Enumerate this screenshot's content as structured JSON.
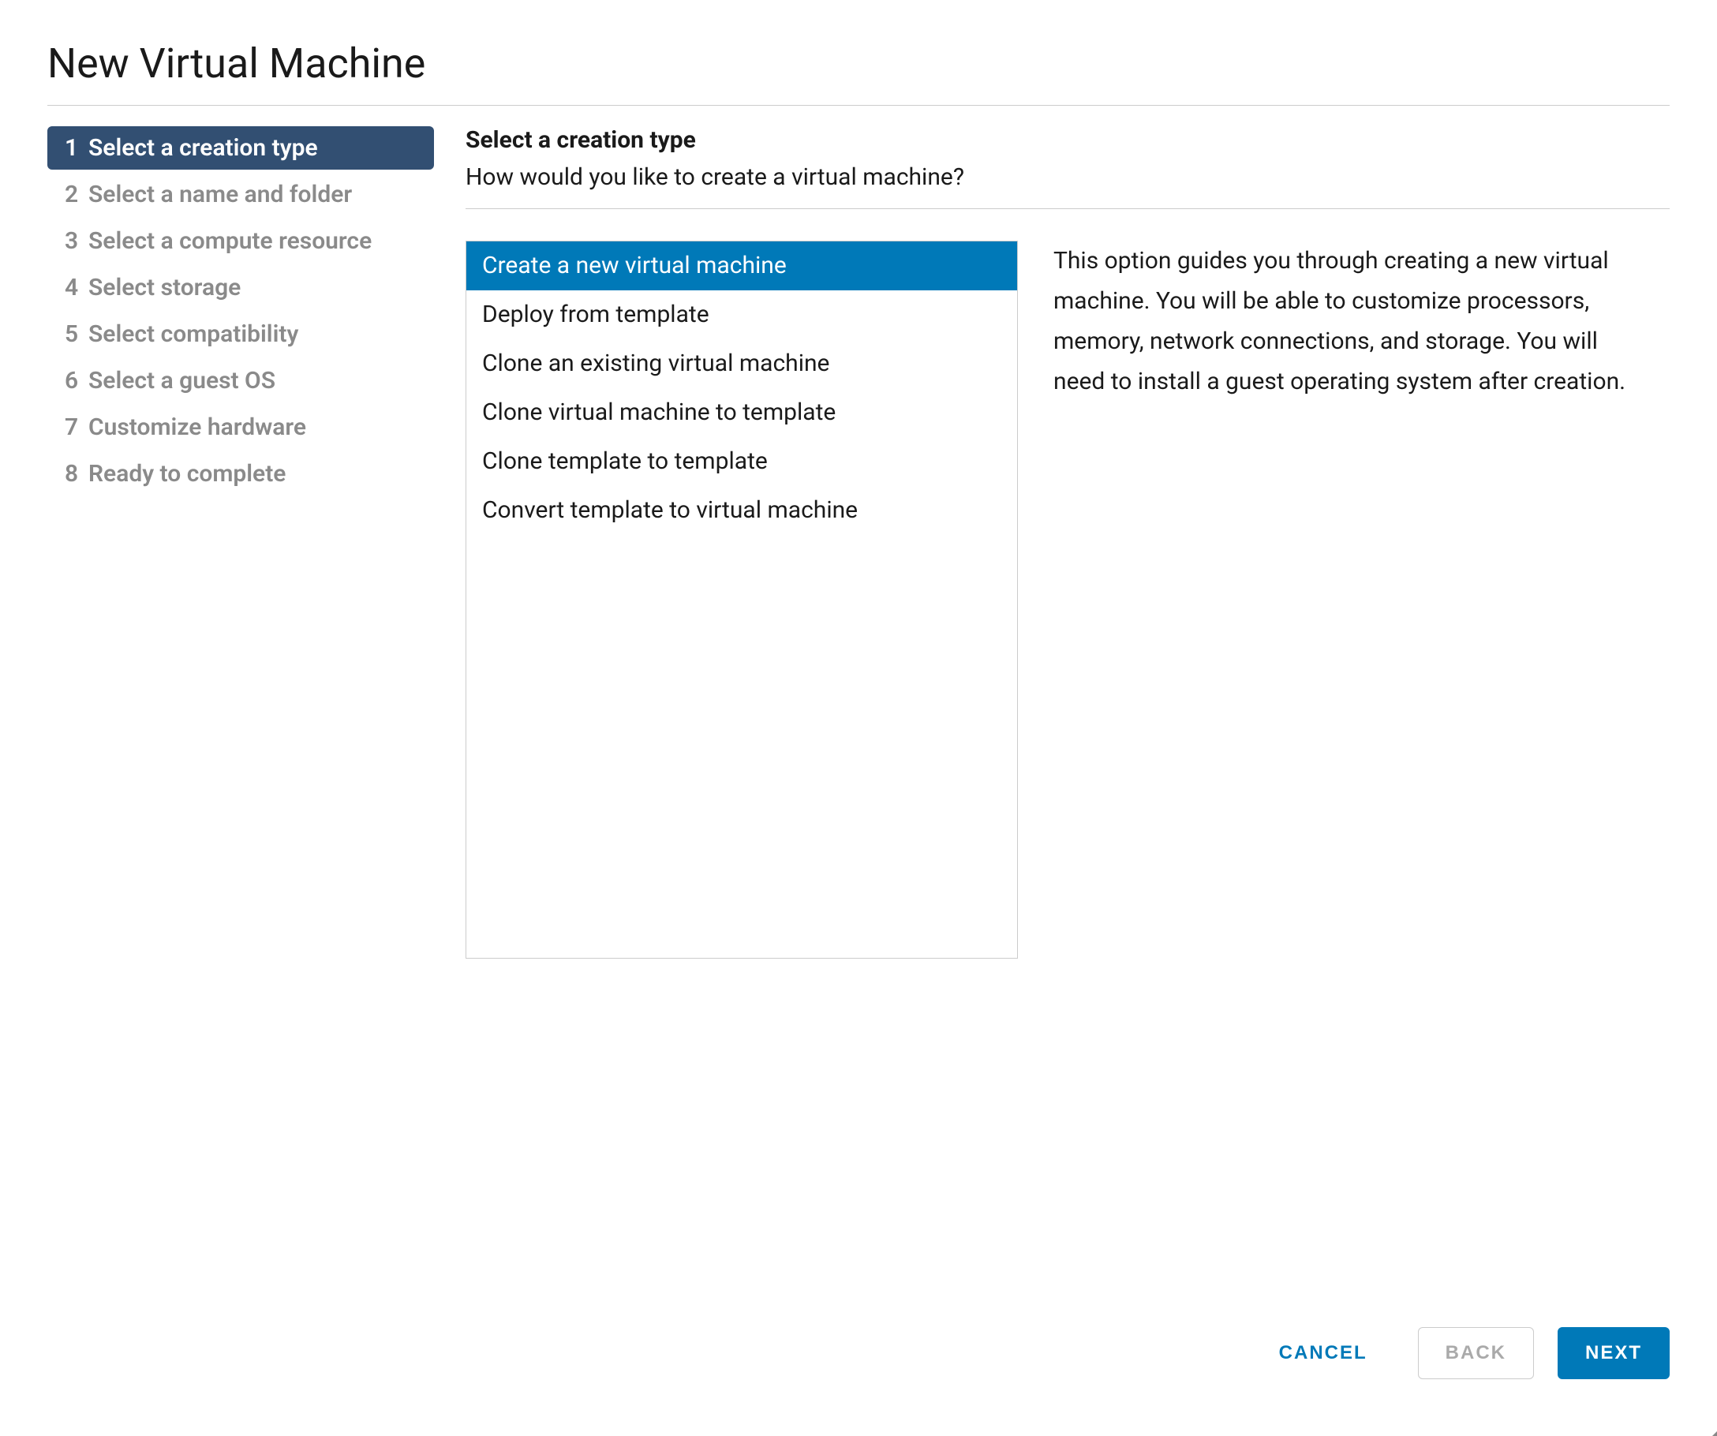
{
  "dialog": {
    "title": "New Virtual Machine"
  },
  "wizard": {
    "steps": [
      {
        "num": "1",
        "label": "Select a creation type",
        "active": true
      },
      {
        "num": "2",
        "label": "Select a name and folder",
        "active": false
      },
      {
        "num": "3",
        "label": "Select a compute resource",
        "active": false
      },
      {
        "num": "4",
        "label": "Select storage",
        "active": false
      },
      {
        "num": "5",
        "label": "Select compatibility",
        "active": false
      },
      {
        "num": "6",
        "label": "Select a guest OS",
        "active": false
      },
      {
        "num": "7",
        "label": "Customize hardware",
        "active": false
      },
      {
        "num": "8",
        "label": "Ready to complete",
        "active": false
      }
    ]
  },
  "panel": {
    "title": "Select a creation type",
    "subtitle": "How would you like to create a virtual machine?",
    "options": [
      {
        "label": "Create a new virtual machine",
        "selected": true
      },
      {
        "label": "Deploy from template",
        "selected": false
      },
      {
        "label": "Clone an existing virtual machine",
        "selected": false
      },
      {
        "label": "Clone virtual machine to template",
        "selected": false
      },
      {
        "label": "Clone template to template",
        "selected": false
      },
      {
        "label": "Convert template to virtual machine",
        "selected": false
      }
    ],
    "description": "This option guides you through creating a new virtual machine. You will be able to customize processors, memory, network connections, and storage. You will need to install a guest operating system after creation."
  },
  "footer": {
    "cancel": "CANCEL",
    "back": "BACK",
    "next": "NEXT"
  }
}
